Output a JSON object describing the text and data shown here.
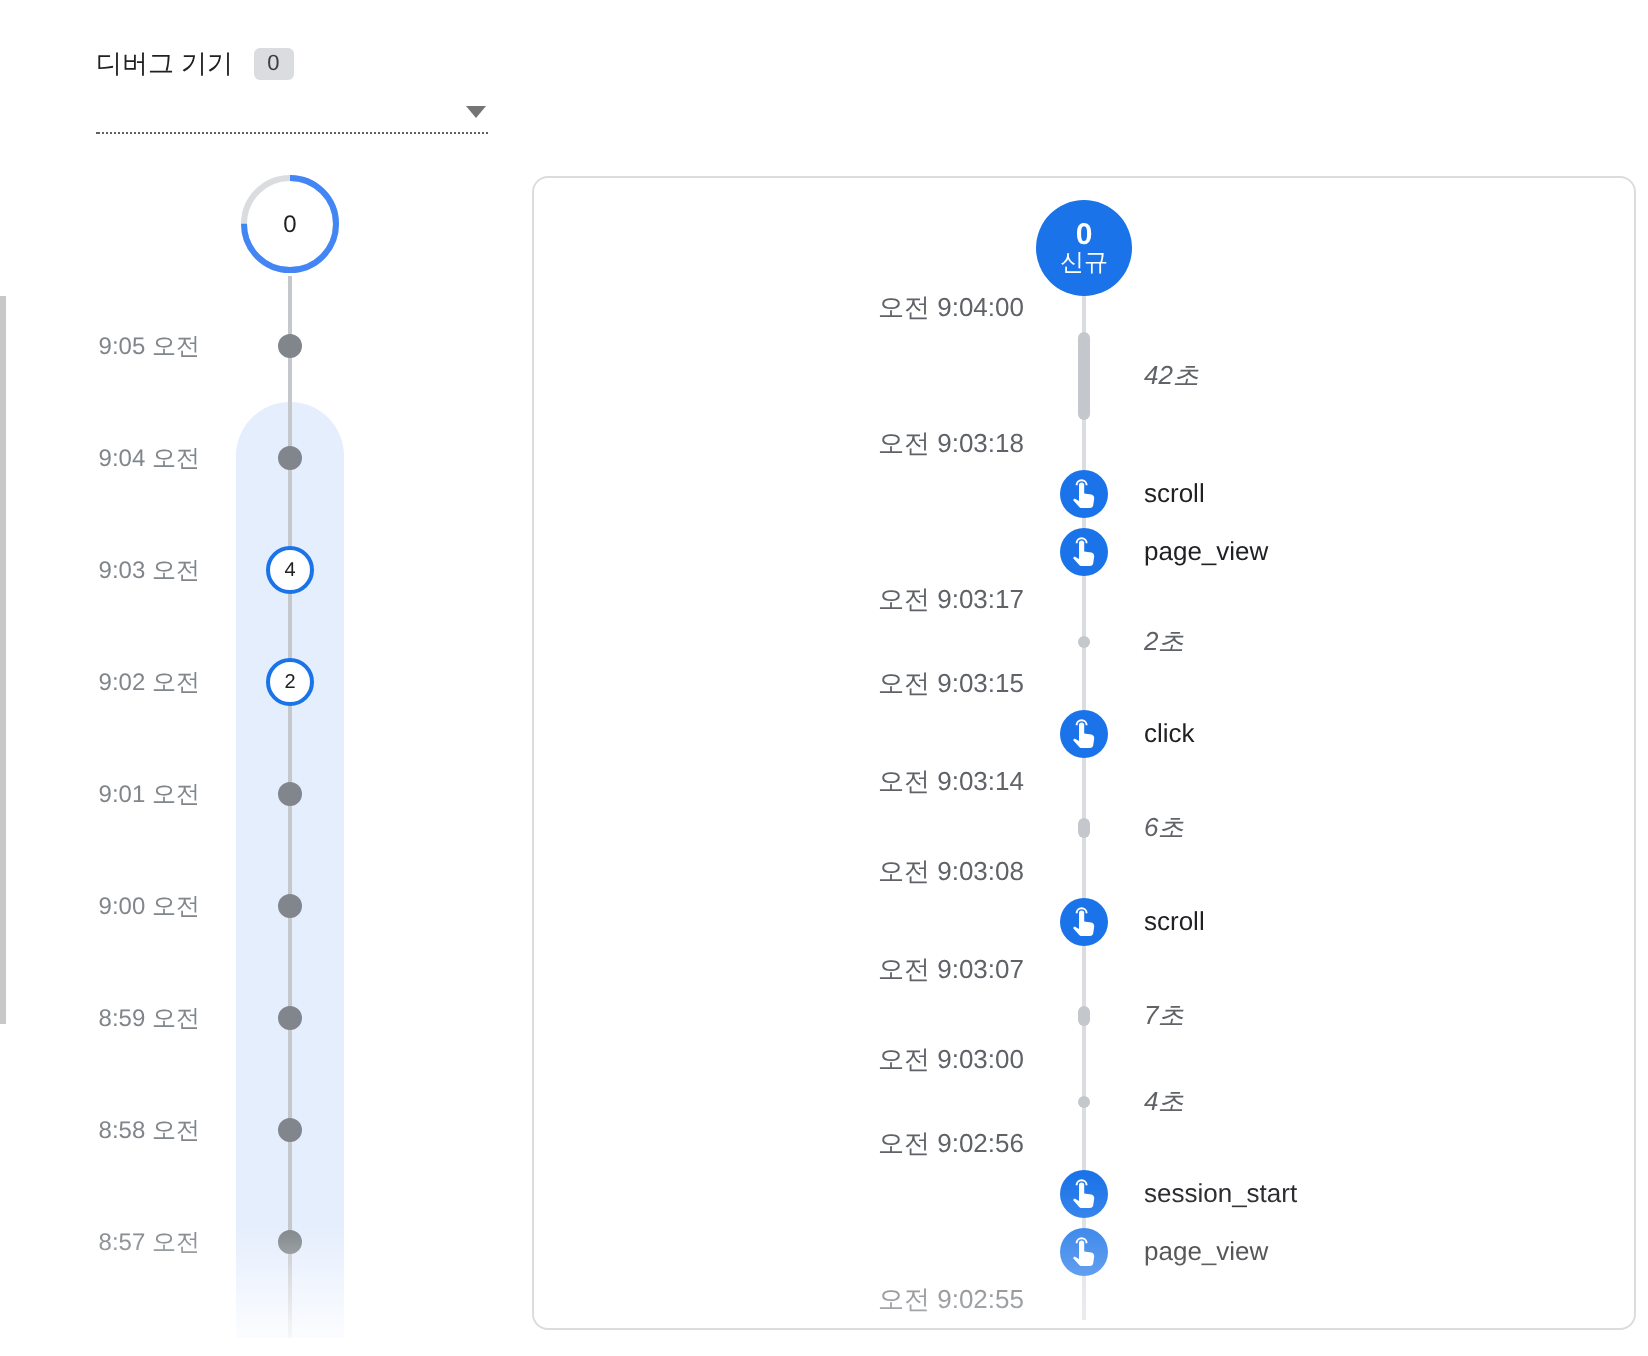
{
  "device_selector": {
    "label": "디버그 기기",
    "count": "0"
  },
  "minutes_timeline": {
    "countdown": {
      "value": "0",
      "level": 0.75
    },
    "minutes": [
      {
        "time": "9:05 오전",
        "kind": "dot",
        "highlighted": false
      },
      {
        "time": "9:04 오전",
        "kind": "dot",
        "highlighted": true
      },
      {
        "time": "9:03 오전",
        "kind": "count",
        "count": "4",
        "highlighted": true
      },
      {
        "time": "9:02 오전",
        "kind": "count",
        "count": "2",
        "highlighted": true
      },
      {
        "time": "9:01 오전",
        "kind": "dot",
        "highlighted": true
      },
      {
        "time": "9:00 오전",
        "kind": "dot",
        "highlighted": true
      },
      {
        "time": "8:59 오전",
        "kind": "dot",
        "highlighted": true
      },
      {
        "time": "8:58 오전",
        "kind": "dot",
        "highlighted": true
      },
      {
        "time": "8:57 오전",
        "kind": "dot",
        "highlighted": true
      }
    ]
  },
  "event_stream": {
    "header": {
      "count": "0",
      "label": "신규"
    },
    "entries": [
      {
        "kind": "time",
        "text": "오전 9:04:00"
      },
      {
        "kind": "longgap",
        "text": "42초"
      },
      {
        "kind": "time",
        "text": "오전 9:03:18"
      },
      {
        "kind": "event",
        "text": "scroll"
      },
      {
        "kind": "event",
        "text": "page_view"
      },
      {
        "kind": "time",
        "text": "오전 9:03:17"
      },
      {
        "kind": "briefgap",
        "text": "2초"
      },
      {
        "kind": "time",
        "text": "오전 9:03:15"
      },
      {
        "kind": "event",
        "text": "click"
      },
      {
        "kind": "time",
        "text": "오전 9:03:14"
      },
      {
        "kind": "shortgap",
        "text": "6초"
      },
      {
        "kind": "time",
        "text": "오전 9:03:08"
      },
      {
        "kind": "event",
        "text": "scroll"
      },
      {
        "kind": "time",
        "text": "오전 9:03:07"
      },
      {
        "kind": "shortgap",
        "text": "7초"
      },
      {
        "kind": "time",
        "text": "오전 9:03:00"
      },
      {
        "kind": "briefgap",
        "text": "4초"
      },
      {
        "kind": "time",
        "text": "오전 9:02:56"
      },
      {
        "kind": "event",
        "text": "session_start"
      },
      {
        "kind": "event",
        "text": "page_view"
      },
      {
        "kind": "time",
        "text": "오전 9:02:55"
      }
    ]
  }
}
